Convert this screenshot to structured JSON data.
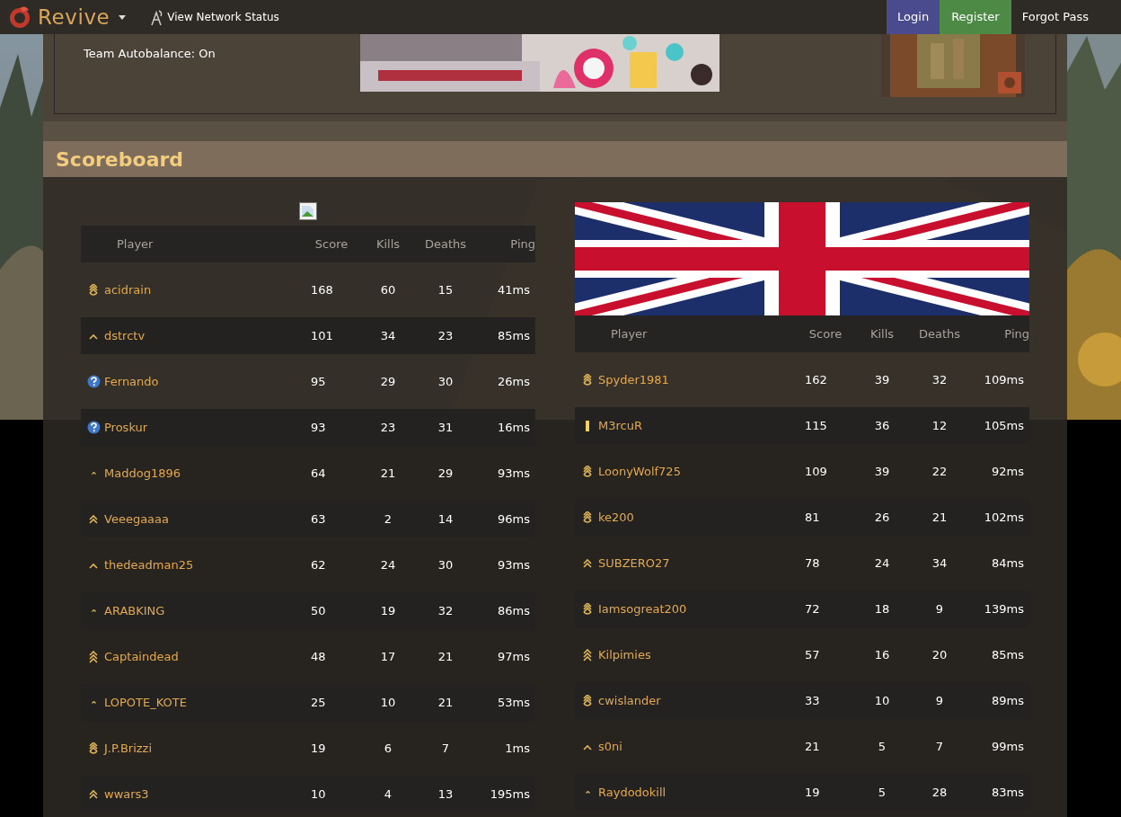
{
  "nav": {
    "logo": "Revive",
    "link": "View Network Status",
    "buttons": [
      {
        "label": "Login",
        "kind": "login"
      },
      {
        "label": "Register",
        "kind": "register"
      },
      {
        "label": "Forgot Pass",
        "kind": "plain"
      }
    ]
  },
  "server_info": {
    "lines": [
      "Team Autobalance: On"
    ],
    "banner": {
      "kind": "picture"
    },
    "map": {
      "kind": "picture"
    }
  },
  "scoreboard": {
    "title": "Scoreboard",
    "teams": [
      {
        "kind": "missing-image",
        "columns": [
          "Player",
          "Score",
          "Kills",
          "Deaths",
          "Ping"
        ],
        "rows": [
          {
            "kind": "stack",
            "player": "acidrain",
            "score": "168",
            "kills": "60",
            "deaths": "15",
            "ping": "41ms"
          },
          {
            "kind": "caret",
            "player": "dstrctv",
            "score": "101",
            "kills": "34",
            "deaths": "23",
            "ping": "85ms"
          },
          {
            "kind": "unknown",
            "player": "Fernando",
            "score": "95",
            "kills": "29",
            "deaths": "30",
            "ping": "26ms"
          },
          {
            "kind": "unknown",
            "player": "Proskur",
            "score": "93",
            "kills": "23",
            "deaths": "31",
            "ping": "16ms"
          },
          {
            "kind": "dot",
            "player": "Maddog1896",
            "score": "64",
            "kills": "21",
            "deaths": "29",
            "ping": "93ms"
          },
          {
            "kind": "double",
            "player": "Veeegaaaa",
            "score": "63",
            "kills": "2",
            "deaths": "14",
            "ping": "96ms"
          },
          {
            "kind": "caret",
            "player": "thedeadman25",
            "score": "62",
            "kills": "24",
            "deaths": "30",
            "ping": "93ms"
          },
          {
            "kind": "dot",
            "player": "ARABKING",
            "score": "50",
            "kills": "19",
            "deaths": "32",
            "ping": "86ms"
          },
          {
            "kind": "triple",
            "player": "Captaindead",
            "score": "48",
            "kills": "17",
            "deaths": "21",
            "ping": "97ms"
          },
          {
            "kind": "dot",
            "player": "LOPOTE_KOTE",
            "score": "25",
            "kills": "10",
            "deaths": "21",
            "ping": "53ms"
          },
          {
            "kind": "stack",
            "player": "J.P.Brizzi",
            "score": "19",
            "kills": "6",
            "deaths": "7",
            "ping": "1ms"
          },
          {
            "kind": "double",
            "player": "wwars3",
            "score": "10",
            "kills": "4",
            "deaths": "13",
            "ping": "195ms"
          }
        ]
      },
      {
        "kind": "flag",
        "columns": [
          "Player",
          "Score",
          "Kills",
          "Deaths",
          "Ping"
        ],
        "rows": [
          {
            "kind": "stack",
            "player": "Spyder1981",
            "score": "162",
            "kills": "39",
            "deaths": "32",
            "ping": "109ms"
          },
          {
            "kind": "bar",
            "player": "M3rcuR",
            "score": "115",
            "kills": "36",
            "deaths": "12",
            "ping": "105ms"
          },
          {
            "kind": "stack",
            "player": "LoonyWolf725",
            "score": "109",
            "kills": "39",
            "deaths": "22",
            "ping": "92ms"
          },
          {
            "kind": "stack",
            "player": "ke200",
            "score": "81",
            "kills": "26",
            "deaths": "21",
            "ping": "102ms"
          },
          {
            "kind": "double",
            "player": "SUBZERO27",
            "score": "78",
            "kills": "24",
            "deaths": "34",
            "ping": "84ms"
          },
          {
            "kind": "stack",
            "player": "Iamsogreat200",
            "score": "72",
            "kills": "18",
            "deaths": "9",
            "ping": "139ms"
          },
          {
            "kind": "triple",
            "player": "Kilpimies",
            "score": "57",
            "kills": "16",
            "deaths": "20",
            "ping": "85ms"
          },
          {
            "kind": "stack",
            "player": "cwislander",
            "score": "33",
            "kills": "10",
            "deaths": "9",
            "ping": "89ms"
          },
          {
            "kind": "caret",
            "player": "s0ni",
            "score": "21",
            "kills": "5",
            "deaths": "7",
            "ping": "99ms"
          },
          {
            "kind": "dot",
            "player": "Raydodokill",
            "score": "19",
            "kills": "5",
            "deaths": "28",
            "ping": "83ms"
          }
        ]
      }
    ]
  }
}
